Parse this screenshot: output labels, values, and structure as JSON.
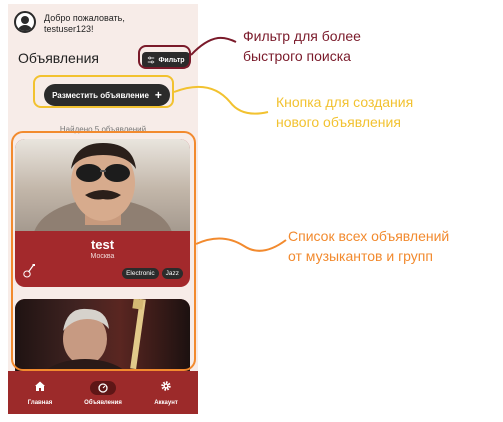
{
  "header": {
    "welcome_line1": "Добро пожаловать,",
    "welcome_line2": "testuser123!"
  },
  "page": {
    "title": "Объявления",
    "filter_label": "Фильтр",
    "post_button_label": "Разместить объявление",
    "post_button_icon": "+",
    "found_text": "Найдено 5 объявлений"
  },
  "listings": [
    {
      "name": "test",
      "city": "Москва",
      "tags": [
        "Electronic",
        "Jazz"
      ],
      "icon": "guitar-icon"
    },
    {
      "icon": "guitar-photo"
    }
  ],
  "navbar": {
    "items": [
      {
        "label": "Главная",
        "icon": "home-icon"
      },
      {
        "label": "Объявления",
        "icon": "search-icon"
      },
      {
        "label": "Аккаунт",
        "icon": "gear-icon"
      }
    ]
  },
  "annotations": {
    "filter": [
      "Фильтр для более",
      "быстрого поиска"
    ],
    "create": [
      "Кнопка для создания",
      "нового объявления"
    ],
    "list": [
      "Список всех объявлений",
      "от музыкантов и групп"
    ]
  },
  "colors": {
    "accent": "#a3292c",
    "dark_button": "#2b2b2b",
    "background": "#f7ece8",
    "filter_annot": "#7a1a2a",
    "create_annot": "#f2c230",
    "list_annot": "#f28a2e"
  }
}
